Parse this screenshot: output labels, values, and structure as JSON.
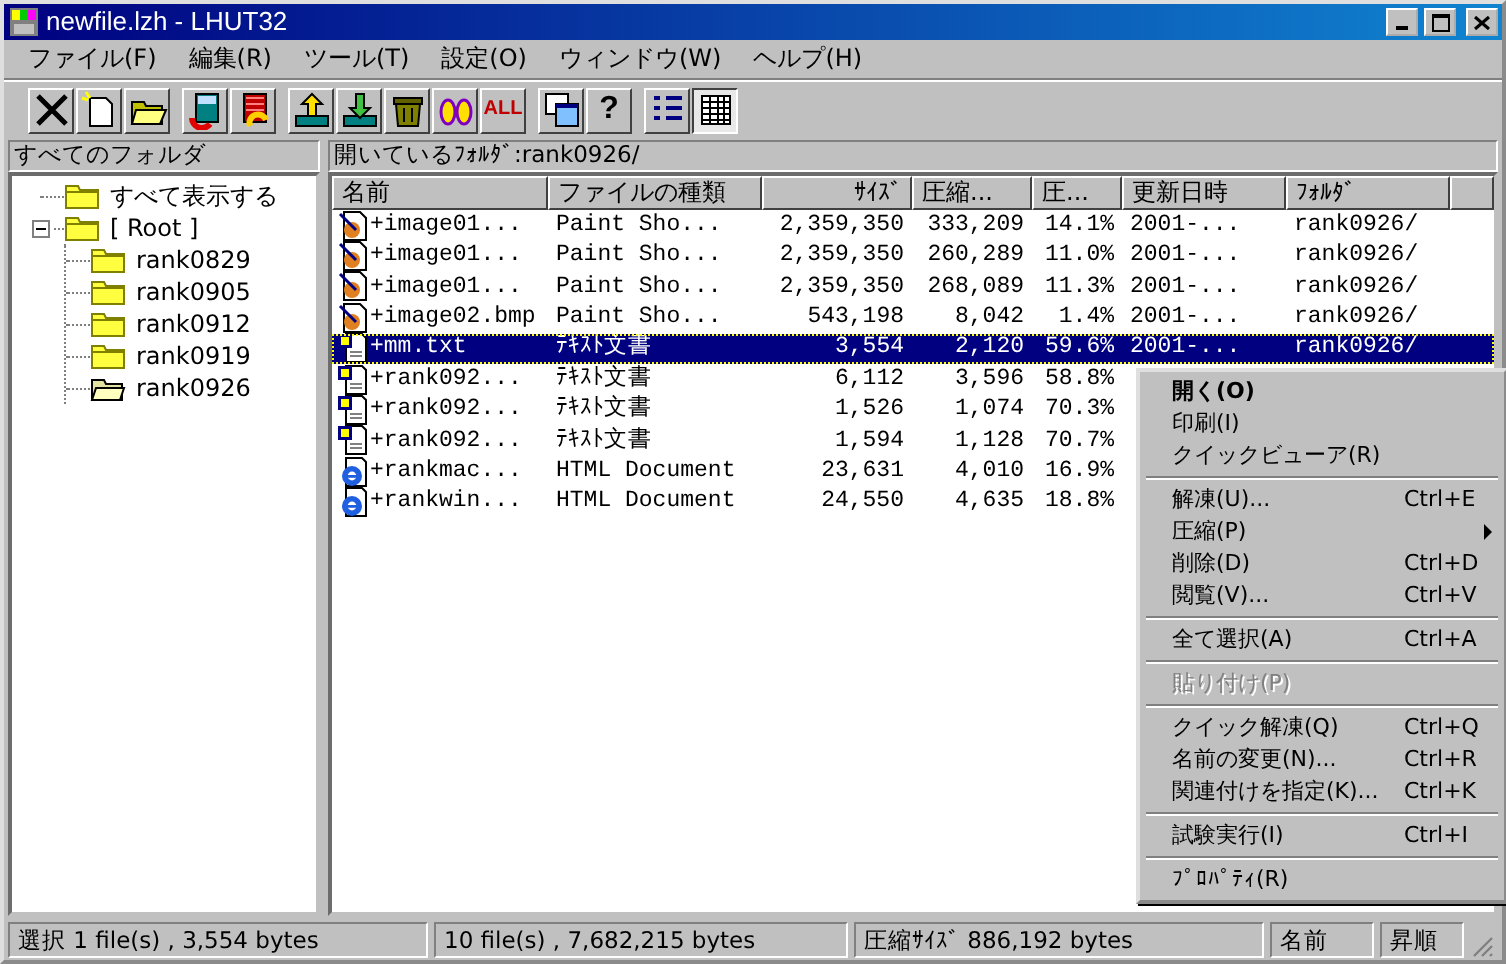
{
  "window": {
    "title": "newfile.lzh - LHUT32"
  },
  "menu": [
    "ファイル(F)",
    "編集(R)",
    "ツール(T)",
    "設定(O)",
    "ウィンドウ(W)",
    "ヘルプ(H)"
  ],
  "toolbar": [
    [
      {
        "kind": "delete",
        "pressed": false
      },
      {
        "kind": "new",
        "pressed": false
      },
      {
        "kind": "open",
        "pressed": false
      }
    ],
    [
      {
        "kind": "archive-red",
        "pressed": false
      },
      {
        "kind": "archive-yellow",
        "pressed": false
      }
    ],
    [
      {
        "kind": "up",
        "pressed": false
      },
      {
        "kind": "down",
        "pressed": false
      },
      {
        "kind": "trash",
        "pressed": false
      },
      {
        "kind": "ovals",
        "pressed": false
      },
      {
        "kind": "text",
        "label": "ALL",
        "pressed": false
      }
    ],
    [
      {
        "kind": "copy",
        "pressed": false
      },
      {
        "kind": "text",
        "label": "?",
        "pressed": false
      }
    ],
    [
      {
        "kind": "list",
        "pressed": false
      },
      {
        "kind": "details",
        "pressed": true
      }
    ]
  ],
  "folders": {
    "title": "すべてのフォルダ",
    "items": [
      {
        "label": "すべて表示する",
        "open": false
      },
      {
        "label": "[ Root ]",
        "open": false,
        "expanded": true,
        "children": [
          {
            "label": "rank0829",
            "open": false
          },
          {
            "label": "rank0905",
            "open": false
          },
          {
            "label": "rank0912",
            "open": false
          },
          {
            "label": "rank0919",
            "open": false
          },
          {
            "label": "rank0926",
            "open": true
          }
        ]
      }
    ]
  },
  "files": {
    "title": "開いているﾌｫﾙﾀﾞ:rank0926/",
    "columns": [
      "名前",
      "ファイルの種類",
      "ｻｲｽﾞ",
      "圧縮...",
      "圧...",
      "更新日時",
      "ﾌｫﾙﾀﾞ"
    ],
    "rows": [
      {
        "kind": "paint",
        "selected": false,
        "cells": [
          "+image01...",
          "Paint Sho...",
          "2,359,350",
          "333,209",
          "14.1%",
          "2001-...",
          "rank0926/"
        ]
      },
      {
        "kind": "paint",
        "selected": false,
        "cells": [
          "+image01...",
          "Paint Sho...",
          "2,359,350",
          "260,289",
          "11.0%",
          "2001-...",
          "rank0926/"
        ]
      },
      {
        "kind": "paint",
        "selected": false,
        "cells": [
          "+image01...",
          "Paint Sho...",
          "2,359,350",
          "268,089",
          "11.3%",
          "2001-...",
          "rank0926/"
        ]
      },
      {
        "kind": "paint",
        "selected": false,
        "cells": [
          "+image02.bmp",
          "Paint Sho...",
          "543,198",
          "8,042",
          "1.4%",
          "2001-...",
          "rank0926/"
        ]
      },
      {
        "kind": "text",
        "selected": true,
        "cells": [
          "+mm.txt",
          "ﾃｷｽﾄ文書",
          "3,554",
          "2,120",
          "59.6%",
          "2001-...",
          "rank0926/"
        ]
      },
      {
        "kind": "text",
        "selected": false,
        "cells": [
          "+rank092...",
          "ﾃｷｽﾄ文書",
          "6,112",
          "3,596",
          "58.8%"
        ]
      },
      {
        "kind": "text",
        "selected": false,
        "cells": [
          "+rank092...",
          "ﾃｷｽﾄ文書",
          "1,526",
          "1,074",
          "70.3%"
        ]
      },
      {
        "kind": "text",
        "selected": false,
        "cells": [
          "+rank092...",
          "ﾃｷｽﾄ文書",
          "1,594",
          "1,128",
          "70.7%"
        ]
      },
      {
        "kind": "html",
        "selected": false,
        "cells": [
          "+rankmac...",
          "HTML Document",
          "23,631",
          "4,010",
          "16.9%"
        ]
      },
      {
        "kind": "html",
        "selected": false,
        "cells": [
          "+rankwin...",
          "HTML Document",
          "24,550",
          "4,635",
          "18.8%"
        ]
      }
    ]
  },
  "context_menu": [
    {
      "kind": "item",
      "label": "開く(O)",
      "default": true,
      "disabled": false,
      "submenu": false
    },
    {
      "kind": "item",
      "label": "印刷(I)",
      "default": false,
      "disabled": false,
      "submenu": false
    },
    {
      "kind": "item",
      "label": "クイックビューア(R)",
      "default": false,
      "disabled": false,
      "submenu": false
    },
    {
      "kind": "separator"
    },
    {
      "kind": "item",
      "label": "解凍(U)...",
      "shortcut": "Ctrl+E",
      "default": false,
      "disabled": false,
      "submenu": false
    },
    {
      "kind": "item",
      "label": "圧縮(P)",
      "default": false,
      "disabled": false,
      "submenu": true
    },
    {
      "kind": "item",
      "label": "削除(D)",
      "shortcut": "Ctrl+D",
      "default": false,
      "disabled": false,
      "submenu": false
    },
    {
      "kind": "item",
      "label": "閲覧(V)...",
      "shortcut": "Ctrl+V",
      "default": false,
      "disabled": false,
      "submenu": false
    },
    {
      "kind": "separator"
    },
    {
      "kind": "item",
      "label": "全て選択(A)",
      "shortcut": "Ctrl+A",
      "default": false,
      "disabled": false,
      "submenu": false
    },
    {
      "kind": "separator"
    },
    {
      "kind": "item",
      "label": "貼り付け(P)",
      "default": false,
      "disabled": true,
      "submenu": false
    },
    {
      "kind": "separator"
    },
    {
      "kind": "item",
      "label": "クイック解凍(Q)",
      "shortcut": "Ctrl+Q",
      "default": false,
      "disabled": false,
      "submenu": false
    },
    {
      "kind": "item",
      "label": "名前の変更(N)...",
      "shortcut": "Ctrl+R",
      "default": false,
      "disabled": false,
      "submenu": false
    },
    {
      "kind": "item",
      "label": "関連付けを指定(K)...",
      "shortcut": "Ctrl+K",
      "default": false,
      "disabled": false,
      "submenu": false
    },
    {
      "kind": "separator"
    },
    {
      "kind": "item",
      "label": "試験実行(I)",
      "shortcut": "Ctrl+I",
      "default": false,
      "disabled": false,
      "submenu": false
    },
    {
      "kind": "separator"
    },
    {
      "kind": "item",
      "label": "ﾌﾟﾛﾊﾟﾃｨ(R)",
      "default": false,
      "disabled": false,
      "submenu": false
    }
  ],
  "status_bar": [
    "選択 1 file(s) , 3,554 bytes",
    "10 file(s) , 7,682,215 bytes",
    "圧縮ｻｲｽﾞ 886,192 bytes",
    "名前",
    "昇順"
  ]
}
